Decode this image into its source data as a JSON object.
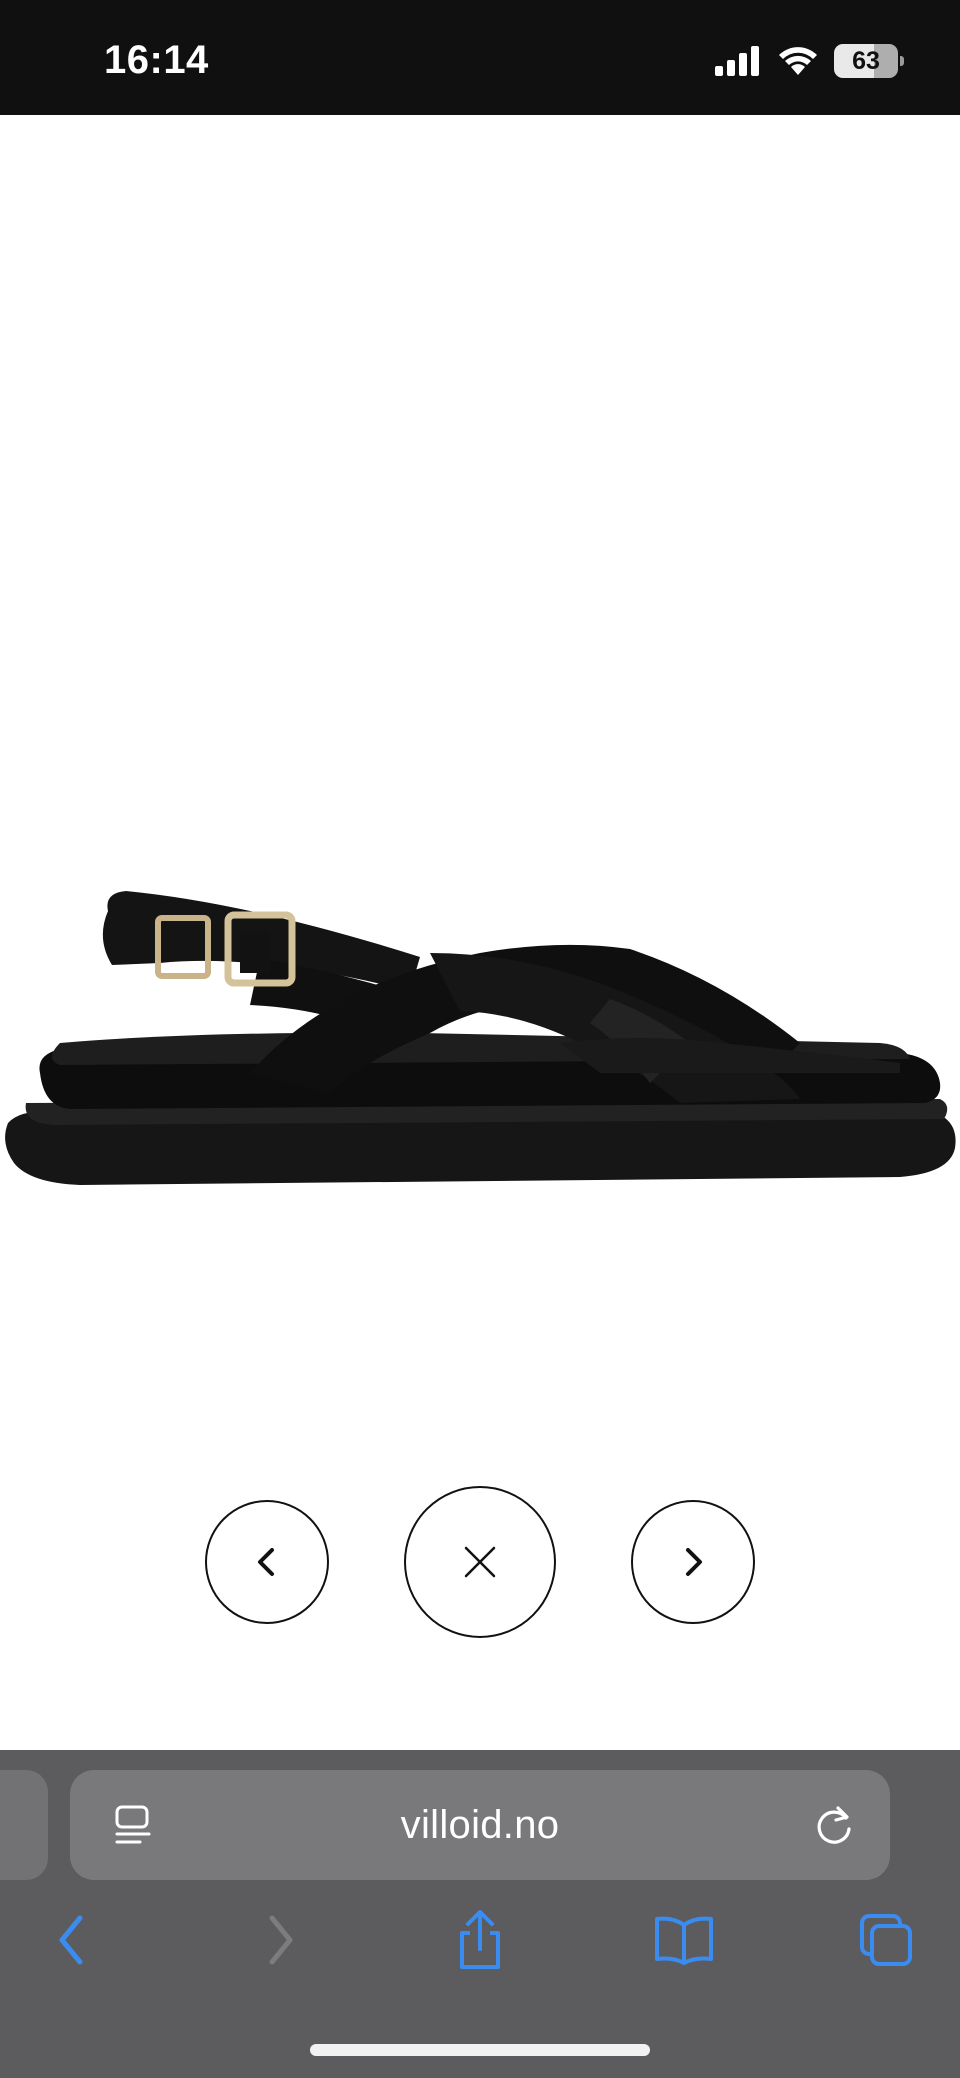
{
  "status_bar": {
    "time": "16:14",
    "battery_level": "63",
    "battery_fraction": 0.63,
    "icons": [
      "cellular-signal-icon",
      "wifi-icon",
      "battery-icon"
    ]
  },
  "product": {
    "image_alt": "Black leather crossover sandal",
    "image_icon": "sandal-image"
  },
  "gallery_controls": {
    "prev_icon": "chevron-left-icon",
    "close_icon": "close-icon",
    "next_icon": "chevron-right-icon"
  },
  "browser": {
    "url": "villoid.no",
    "reader_icon": "reader-mode-icon",
    "reload_icon": "reload-icon",
    "toolbar": [
      "back-icon",
      "forward-icon",
      "share-icon",
      "bookmarks-icon",
      "tabs-icon"
    ]
  },
  "colors": {
    "status_bar_bg": "#101010",
    "browser_bg": "#5c5c5e",
    "address_bar_bg": "#79797b",
    "accent_blue": "#3b8cf0",
    "disabled_gray": "#7c7c7e"
  }
}
